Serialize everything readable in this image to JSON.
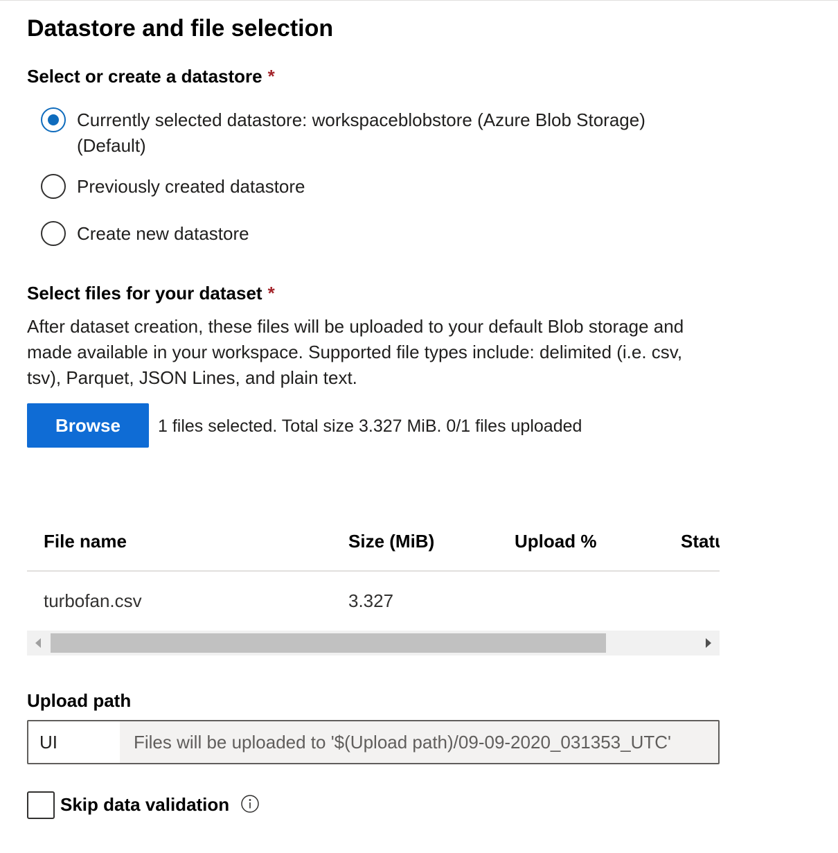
{
  "section": {
    "title": "Datastore and file selection",
    "datastore_label": "Select or create a datastore",
    "required_mark": "*"
  },
  "datastore_options": [
    {
      "label": "Currently selected datastore: workspaceblobstore (Azure Blob Storage) (Default)",
      "checked": true
    },
    {
      "label": "Previously created datastore",
      "checked": false
    },
    {
      "label": "Create new datastore",
      "checked": false
    }
  ],
  "files": {
    "label": "Select files for your dataset",
    "description": "After dataset creation, these files will be uploaded to your default Blob storage and made available in your workspace. Supported file types include: delimited (i.e. csv, tsv), Parquet, JSON Lines, and plain text.",
    "browse_label": "Browse",
    "status_text": "1 files selected. Total size 3.327 MiB. 0/1 files uploaded"
  },
  "table": {
    "columns": [
      "File name",
      "Size (MiB)",
      "Upload %",
      "Statu"
    ],
    "rows": [
      {
        "file_name": "turbofan.csv",
        "size": "3.327",
        "upload": "",
        "status": ""
      }
    ],
    "scrollbar": {
      "thumb_fraction": 0.86
    }
  },
  "upload_path": {
    "label": "Upload path",
    "value": "UI",
    "suffix": "Files will be uploaded to '$(Upload path)/09-09-2020_031353_UTC'"
  },
  "skip_validation": {
    "label": "Skip data validation",
    "checked": false,
    "info_icon": "info-icon"
  },
  "colors": {
    "accent": "#0f6cbd",
    "button": "#0f6cd5",
    "required": "#a4262c"
  }
}
